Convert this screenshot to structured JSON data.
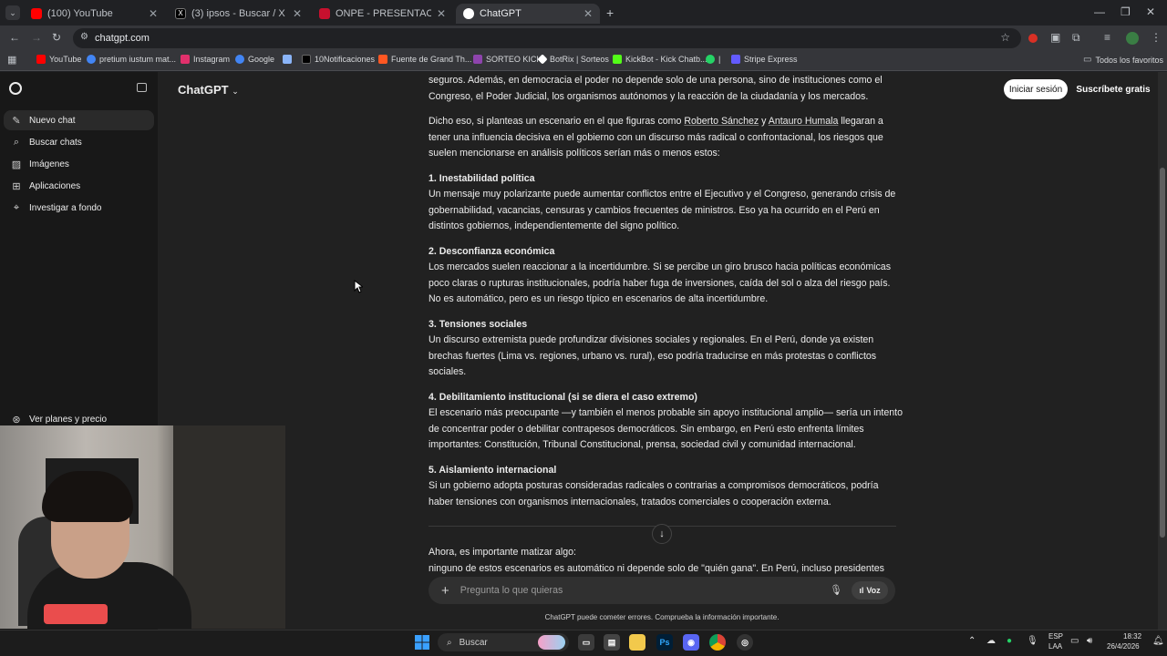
{
  "browser": {
    "tabs": [
      {
        "title": "(100) YouTube",
        "icon": "youtube-icon",
        "color": "#ff0000"
      },
      {
        "title": "(3) ipsos - Buscar / X",
        "icon": "x-icon",
        "color": "#000000"
      },
      {
        "title": "ONPE - PRESENTACIÓN DE RES",
        "icon": "onpe-icon",
        "color": "#c8102e"
      },
      {
        "title": "ChatGPT",
        "icon": "chatgpt-icon",
        "color": "#ffffff"
      }
    ],
    "url": "chatgpt.com",
    "bookmarks": [
      {
        "label": "YouTube",
        "color": "#ff0000"
      },
      {
        "label": "pretium iustum mat...",
        "color": "#4285f4"
      },
      {
        "label": "Instagram",
        "color": "#e1306c"
      },
      {
        "label": "Google",
        "color": "#4285f4"
      },
      {
        "label": "",
        "color": "#8ab4f8"
      },
      {
        "label": "10Notificaciones",
        "color": "#000000"
      },
      {
        "label": "Fuente de Grand Th...",
        "color": "#ff5722"
      },
      {
        "label": "SORTEO KICK",
        "color": "#8e44ad"
      },
      {
        "label": "BotRix | Sorteos",
        "color": "#ffffff"
      },
      {
        "label": "KickBot - Kick Chatb...",
        "color": "#53fc18"
      },
      {
        "label": "|",
        "color": "#25d366"
      },
      {
        "label": "Stripe Express",
        "color": "#635bff"
      }
    ],
    "all_bookmarks": "Todos los favoritos"
  },
  "sidebar": {
    "items": [
      {
        "label": "Nuevo chat",
        "icon": "edit-icon"
      },
      {
        "label": "Buscar chats",
        "icon": "search-icon"
      },
      {
        "label": "Imágenes",
        "icon": "image-icon"
      },
      {
        "label": "Aplicaciones",
        "icon": "apps-icon"
      },
      {
        "label": "Investigar a fondo",
        "icon": "telescope-icon"
      }
    ],
    "plans": "Ver planes y precio"
  },
  "header": {
    "model": "ChatGPT",
    "login": "Iniciar sesión",
    "signup": "Suscríbete gratis"
  },
  "message": {
    "intro_tail": "seguros. Además, en democracia el poder no depende solo de una persona, sino de instituciones como el Congreso, el Poder Judicial, los organismos autónomos y la reacción de la ciudadanía y los mercados.",
    "p2_a": "Dicho eso, si planteas un escenario en el que figuras como ",
    "p2_link1": "Roberto Sánchez",
    "p2_b": " y ",
    "p2_link2": "Antauro Humala",
    "p2_c": " llegaran a tener una influencia decisiva en el gobierno con un discurso más radical o confrontacional, los riesgos que suelen mencionarse en análisis políticos serían más o menos estos:",
    "points": [
      {
        "title": "1. Inestabilidad política",
        "body": "Un mensaje muy polarizante puede aumentar conflictos entre el Ejecutivo y el Congreso, generando crisis de gobernabilidad, vacancias, censuras y cambios frecuentes de ministros. Eso ya ha ocurrido en el Perú en distintos gobiernos, independientemente del signo político."
      },
      {
        "title": "2. Desconfianza económica",
        "body": "Los mercados suelen reaccionar a la incertidumbre. Si se percibe un giro brusco hacia políticas económicas poco claras o rupturas institucionales, podría haber fuga de inversiones, caída del sol o alza del riesgo país. No es automático, pero es un riesgo típico en escenarios de alta incertidumbre."
      },
      {
        "title": "3. Tensiones sociales",
        "body": "Un discurso extremista puede profundizar divisiones sociales y regionales. En el Perú, donde ya existen brechas fuertes (Lima vs. regiones, urbano vs. rural), eso podría traducirse en más protestas o conflictos sociales."
      },
      {
        "title": "4. Debilitamiento institucional (si se diera el caso extremo)",
        "body": "El escenario más preocupante —y también el menos probable sin apoyo institucional amplio— sería un intento de concentrar poder o debilitar contrapesos democráticos. Sin embargo, en Perú esto enfrenta límites importantes: Constitución, Tribunal Constitucional, prensa, sociedad civil y comunidad internacional."
      },
      {
        "title": "5. Aislamiento internacional",
        "body": "Si un gobierno adopta posturas consideradas radicales o contrarias a compromisos democráticos, podría haber tensiones con organismos internacionales, tratados comerciales o cooperación externa."
      }
    ],
    "closing1": "Ahora, es importante matizar algo:",
    "closing2": "ninguno de estos escenarios es automático ni depende solo de \"quién gana\". En Perú, incluso presidentes"
  },
  "composer": {
    "placeholder": "Pregunta lo que quieras",
    "voice": "Voz",
    "disclaimer": "ChatGPT puede cometer errores. Comprueba la información importante."
  },
  "taskbar": {
    "search": "Buscar",
    "lang1": "ESP",
    "lang2": "LAA",
    "time": "18:32",
    "date": "26/4/2026"
  }
}
